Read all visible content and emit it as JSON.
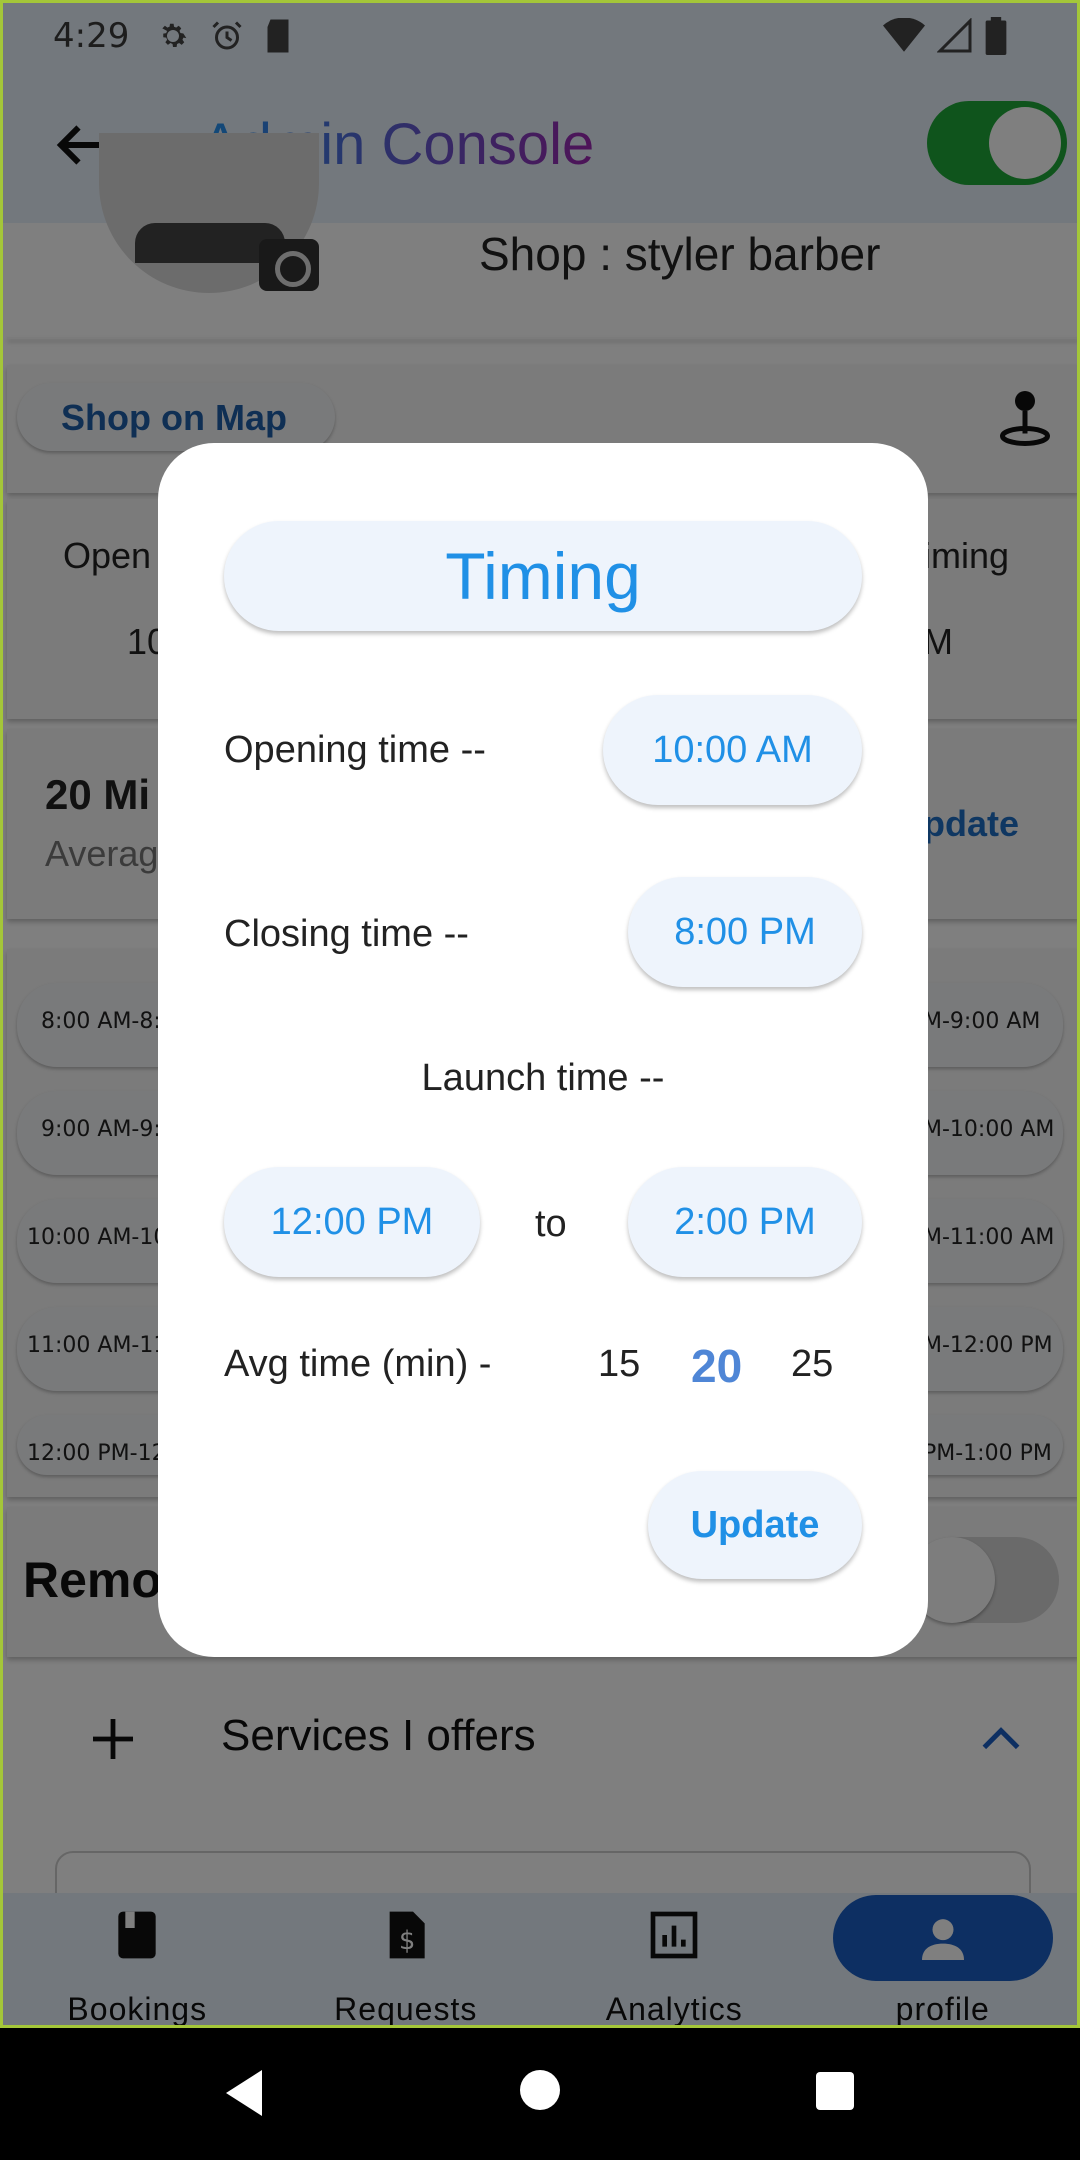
{
  "status": {
    "time": "4:29"
  },
  "appbar": {
    "title": "Admin Console",
    "toggle_on": true
  },
  "shop": {
    "name": "Shop : styler barber",
    "map_button": "Shop on Map"
  },
  "background": {
    "opening_label_partial": "Open",
    "opening_value_partial": "10",
    "timing_label_partial": "iming",
    "timing_value_partial": "M",
    "avg_big_partial": "20 Mi",
    "avg_sub_partial": "Averag",
    "update_partial": "pdate",
    "slots_left": [
      "8:00 AM-8:",
      "9:00 AM-9:",
      "10:00 AM-10",
      "11:00 AM-11",
      "12:00 PM-12"
    ],
    "slots_right": [
      "M-9:00 AM",
      "M-10:00 AM",
      "M-11:00 AM",
      "M-12:00 PM",
      "PM-1:00 PM"
    ],
    "remove_partial": "Remo",
    "services": "Services I offers"
  },
  "dialog": {
    "title": "Timing",
    "opening_label": "Opening time --",
    "opening_value": "10:00 AM",
    "closing_label": "Closing time --",
    "closing_value": "8:00 PM",
    "launch_label": "Launch time --",
    "launch_from": "12:00 PM",
    "launch_to_word": "to",
    "launch_to": "2:00 PM",
    "avg_label": "Avg time (min) -",
    "avg_options": [
      "15",
      "20",
      "25"
    ],
    "avg_selected": "20",
    "update_button": "Update"
  },
  "bottom_nav": [
    {
      "label": "Bookings",
      "icon": "book-icon"
    },
    {
      "label": "Requests",
      "icon": "invoice-icon"
    },
    {
      "label": "Analytics",
      "icon": "bar-chart-icon"
    },
    {
      "label": "profile",
      "icon": "person-icon",
      "active": true
    }
  ],
  "colors": {
    "accent": "#2090e6",
    "switch_on": "#1fa838",
    "nav_active": "#1a5fc4"
  }
}
